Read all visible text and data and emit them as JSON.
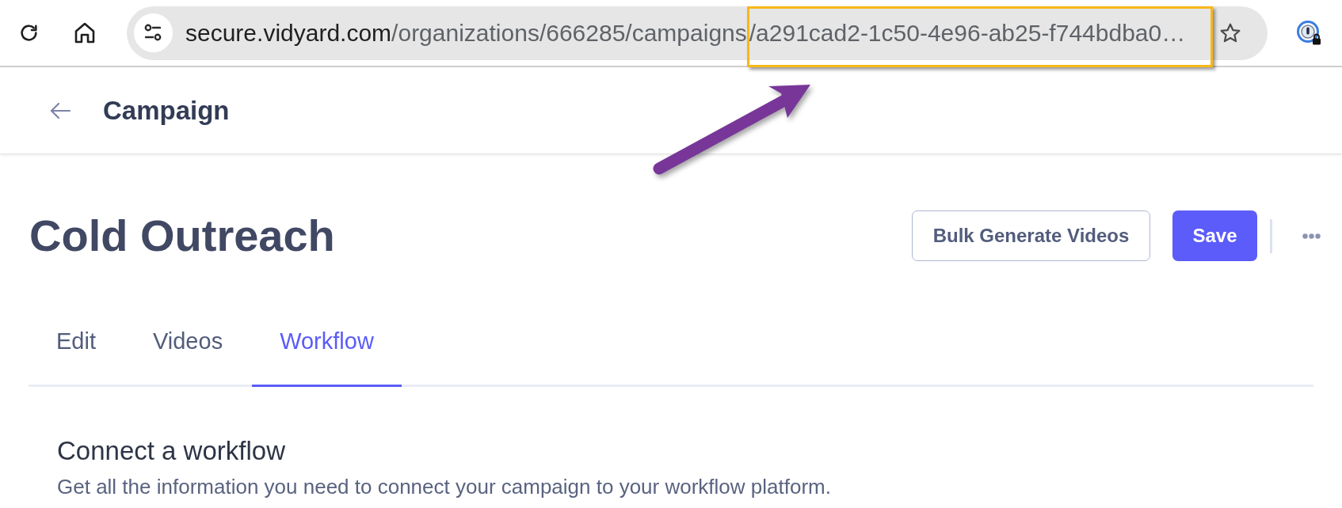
{
  "browser": {
    "url_parts": [
      {
        "text": "secure.vidyard.com",
        "kind": "host",
        "highlighted": false
      },
      {
        "text": "/organizations/666285/campaigns",
        "kind": "path",
        "highlighted": false
      },
      {
        "text": "/a291cad2-1c50-4e96-ab25-f744bdba0…",
        "kind": "path",
        "highlighted": true
      }
    ],
    "annotation_arrow": true
  },
  "header": {
    "title": "Campaign"
  },
  "page": {
    "title": "Cold Outreach",
    "buttons": [
      {
        "label": "Bulk Generate Videos",
        "kind": "secondary"
      },
      {
        "label": "Save",
        "kind": "primary"
      }
    ]
  },
  "tabs": [
    {
      "label": "Edit",
      "selected": false
    },
    {
      "label": "Videos",
      "selected": false
    },
    {
      "label": "Workflow",
      "selected": true
    }
  ],
  "section": {
    "title": "Connect a workflow",
    "description": "Get all the information you need to connect your campaign to your workflow platform."
  }
}
